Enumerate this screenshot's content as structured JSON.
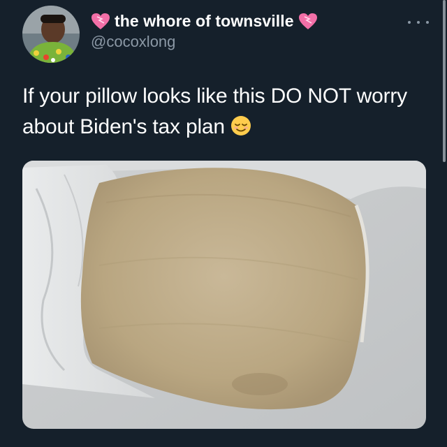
{
  "tweet": {
    "display_name": "the whore of townsville",
    "handle": "@cocoxlong",
    "text": "If your pillow looks like this DO NOT worry about Biden's tax plan",
    "emoji": "relieved-face",
    "name_badges": [
      "pink-heart-icon",
      "pink-heart-icon"
    ],
    "media_subject": "stained pillow photo"
  },
  "colors": {
    "background": "#15202b",
    "primary_text": "#ffffff",
    "secondary_text": "#8b98a5"
  }
}
